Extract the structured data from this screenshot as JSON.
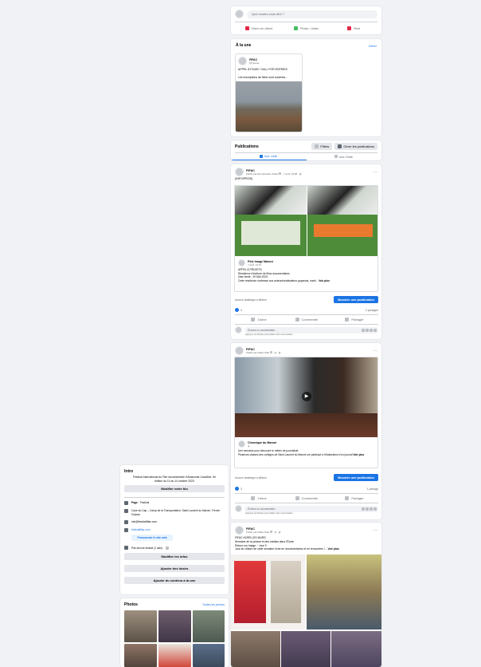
{
  "composer": {
    "placeholder": "Que voulez-vous dire ?",
    "live": "Vidéo en direct",
    "photo": "Photo / vidéo",
    "reel": "Reel"
  },
  "featured": {
    "title": "À la une",
    "manage": "Gérer",
    "card_name": "FIFAC",
    "card_date": "16 février",
    "card_title": "APPEL À FILMS / CALL FOR ENTRIES",
    "card_text": "Les inscriptions de films sont ouvertes..."
  },
  "publications": {
    "title": "Publications",
    "filters": "Filtres",
    "manage": "Gérer les publications",
    "list_view": "Vue Liste",
    "grid_view": "Vue Grille"
  },
  "post1": {
    "author": "FIFAC",
    "meta": "Publié par Emmanuelle Chalet",
    "date": "7 avril, 15:58",
    "text": "(INFO/PROD)",
    "shared_name": "Pôle Image Maroni",
    "shared_date": "7 avril, 14:37",
    "line1": "APPEL À PROJETS",
    "line2": "Résidence d'écriture de films documentaires",
    "line3": "Date limite : 29 MAI 2023",
    "line4": "Cette résidence s'adresse aux auteurs/réalisateurs guyanais, marti...",
    "see_more": "Voir plus",
    "stats": "Aucune statistique à afficher",
    "boost": "Booster une publication",
    "reactions": "4",
    "shares": "2 partages",
    "like": "J'aime",
    "comment": "Commenter",
    "share": "Partager",
    "comment_placeholder": "Écrivez un commentaire...",
    "hint": "Appuyez sur Entrée pour publier votre commentaire."
  },
  "post2": {
    "author": "FIFAC",
    "meta": "Publié par Killian Pilar",
    "date": "4j",
    "shared_name": "Chronique du Maroni",
    "shared_date": "4j",
    "line1": "Une semaine pour découvrir le métier de journaliste",
    "line2": "Plusieurs classes des collèges de Saint Laurent du Maroni ont participé à l'élaboration d'un journal",
    "see_more": "Voir plus",
    "stats": "Aucune statistique à afficher",
    "boost": "Booster une publication",
    "reactions": "3",
    "shares": "1 partage",
    "like": "J'aime",
    "comment": "Commenter",
    "share": "Partager",
    "comment_placeholder": "Écrivez un commentaire...",
    "hint": "Appuyez sur Entrée pour publier votre commentaire."
  },
  "post3": {
    "author": "FIFAC",
    "meta": "Publié par Killian Pilar",
    "date": "4j",
    "line1": "FIFAC HORS LES MURS",
    "line2": "Semaine de la presse et des médias dans l'École",
    "line3": "Retour sur Image ~ Jour 5",
    "line4": "Jour de clôture de cette semaine riche en documentaires et en rencontres !...",
    "see_more": "Voir plus"
  },
  "intro": {
    "title": "Intro",
    "bio": "Festival International du Film documentaire d'Amazonie-Caraïbes. 9e édition du 10 au 14 octobre 2023",
    "edit_bio": "Modifier votre bio",
    "page_label": "Page",
    "page_type": "Festival",
    "address": "Case du Cap – Camp de la Transportation, Saint-Laurent du Maroni, French Guiana",
    "email": "info@festivalfifac.com",
    "website": "festivalfifac.com",
    "promote": "Promouvoir le site web",
    "rating": "Pas encore évalué (1 avis)",
    "edit_info": "Modifier les infos",
    "add_hobbies": "Ajouter des loisirs",
    "add_featured": "Ajouter du contenu à la une"
  },
  "photos": {
    "title": "Photos",
    "see_all": "Toutes les photos"
  }
}
